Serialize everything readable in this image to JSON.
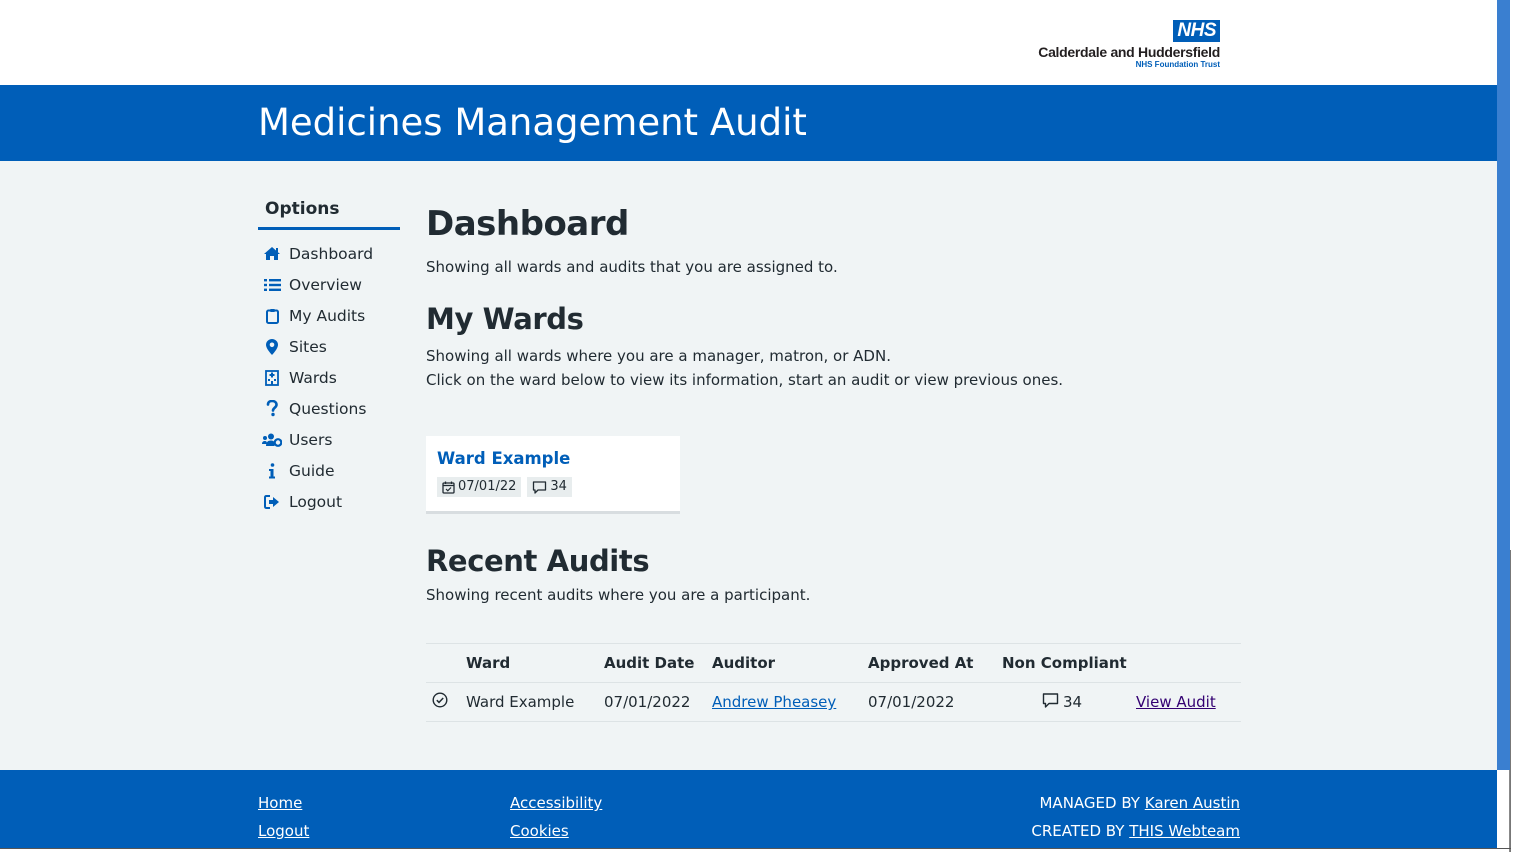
{
  "header": {
    "logo": {
      "badge": "NHS",
      "organisation": "Calderdale and Huddersfield",
      "trust": "NHS Foundation Trust"
    },
    "app_title": "Medicines Management Audit"
  },
  "sidebar": {
    "title": "Options",
    "items": [
      {
        "label": "Dashboard",
        "icon": "home-icon"
      },
      {
        "label": "Overview",
        "icon": "list-icon"
      },
      {
        "label": "My Audits",
        "icon": "clipboard-icon"
      },
      {
        "label": "Sites",
        "icon": "map-marker-icon"
      },
      {
        "label": "Wards",
        "icon": "hospital-building-icon"
      },
      {
        "label": "Questions",
        "icon": "question-icon"
      },
      {
        "label": "Users",
        "icon": "users-cog-icon"
      },
      {
        "label": "Guide",
        "icon": "info-icon"
      },
      {
        "label": "Logout",
        "icon": "sign-out-icon"
      }
    ]
  },
  "main": {
    "title": "Dashboard",
    "subtitle": "Showing all wards and audits that you are assigned to.",
    "my_wards": {
      "heading": "My Wards",
      "line1": "Showing all wards where you are a manager, matron, or ADN.",
      "line2": "Click on the ward below to view its information, start an audit or view previous ones.",
      "cards": [
        {
          "name": "Ward Example",
          "date": "07/01/22",
          "comments": "34"
        }
      ]
    },
    "recent_audits": {
      "heading": "Recent Audits",
      "subtitle": "Showing recent audits where you are a participant.",
      "columns": [
        "",
        "Ward",
        "Audit Date",
        "Auditor",
        "Approved At",
        "Non Compliant",
        ""
      ],
      "rows": [
        {
          "status_icon": "check-circle-icon",
          "ward": "Ward Example",
          "audit_date": "07/01/2022",
          "auditor": "Andrew Pheasey",
          "approved_at": "07/01/2022",
          "non_compliant": "34",
          "action": "View Audit"
        }
      ]
    }
  },
  "footer": {
    "links_col1": [
      "Home",
      "Logout"
    ],
    "links_col2": [
      "Accessibility",
      "Cookies"
    ],
    "managed_by_label": "MANAGED BY",
    "managed_by_name": "Karen Austin",
    "created_by_label": "CREATED BY",
    "created_by_name": "THIS Webteam"
  },
  "colors": {
    "nhs_blue": "#005eb8",
    "background": "#f0f4f5",
    "text": "#212b32",
    "visited_link": "#330072"
  }
}
